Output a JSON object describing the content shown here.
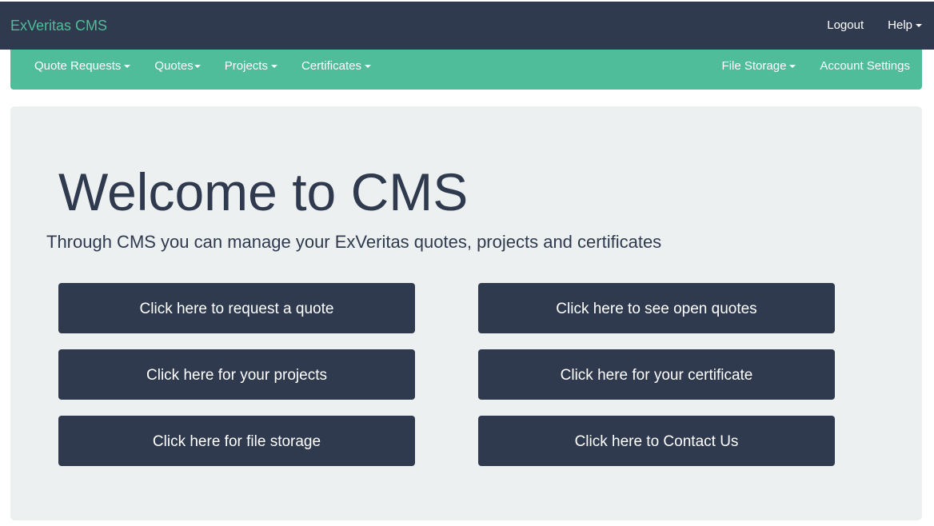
{
  "navbar": {
    "brand": "ExVeritas CMS",
    "right_links": [
      {
        "label": "Logout",
        "has_caret": false
      },
      {
        "label": "Help",
        "has_caret": true
      }
    ]
  },
  "subnav": {
    "left_items": [
      {
        "label": "Quote Requests",
        "has_caret": true
      },
      {
        "label": "Quotes",
        "has_caret": true
      },
      {
        "label": "Projects",
        "has_caret": true
      },
      {
        "label": "Certificates",
        "has_caret": true
      }
    ],
    "right_items": [
      {
        "label": "File Storage",
        "has_caret": true
      },
      {
        "label": "Account Settings",
        "has_caret": false
      }
    ]
  },
  "main": {
    "title": "Welcome to CMS",
    "subtitle": "Through CMS you can manage your ExVeritas quotes, projects and certificates",
    "buttons": [
      {
        "label": "Click here to request a quote"
      },
      {
        "label": "Click here to see open quotes"
      },
      {
        "label": "Click here for your projects"
      },
      {
        "label": "Click here for your certificate"
      },
      {
        "label": "Click here for file storage"
      },
      {
        "label": "Click here to Contact Us"
      }
    ]
  },
  "colors": {
    "dark": "#2f3a4e",
    "accent": "#4fbd9a",
    "panel": "#ecf0f1",
    "text_on_dark": "#ffffff"
  },
  "icons": {
    "dropdown": "caret-down-icon"
  }
}
